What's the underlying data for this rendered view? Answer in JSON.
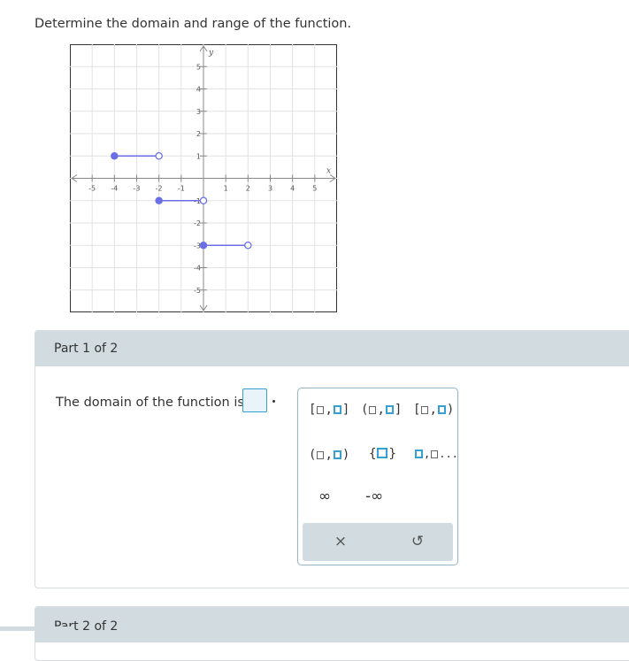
{
  "question": "Determine the domain and range of the function.",
  "graph": {
    "x_axis_label": "x",
    "y_axis_label": "y",
    "x_ticks": [
      "-5",
      "-4",
      "-3",
      "-2",
      "-1",
      "1",
      "2",
      "3",
      "4",
      "5"
    ],
    "y_ticks": [
      "5",
      "4",
      "3",
      "2",
      "1",
      "-1",
      "-2",
      "-3",
      "-4",
      "-5"
    ],
    "xlim": [
      -6,
      6
    ],
    "ylim": [
      -6,
      6
    ],
    "segment_color": "#6b6fe6",
    "segments": [
      {
        "x1": -4,
        "x2": -2,
        "y": 1,
        "closed_left": true,
        "closed_right": false
      },
      {
        "x1": -2,
        "x2": 0,
        "y": -1,
        "closed_left": true,
        "closed_right": false
      },
      {
        "x1": 0,
        "x2": 2,
        "y": -3,
        "closed_left": true,
        "closed_right": false
      }
    ]
  },
  "part1": {
    "header": "Part 1 of 2",
    "sentence": "The domain of the function is",
    "answer_value": "",
    "period": "."
  },
  "palette": {
    "closed_closed": [
      "[",
      ",",
      "]"
    ],
    "open_closed": [
      "(",
      ",",
      "]"
    ],
    "closed_open": [
      "[",
      ",",
      ")"
    ],
    "open_open": [
      "(",
      ",",
      ")"
    ],
    "set_braces": [
      "{",
      "}"
    ],
    "list_ellipsis": "...",
    "infinity": "∞",
    "neg_infinity": "-∞",
    "clear_icon": "×",
    "undo_icon": "↺"
  },
  "part2": {
    "header": "Part 2 of 2"
  },
  "colors": {
    "accent": "#37a0d3",
    "header_bg": "#d2dbdf"
  }
}
